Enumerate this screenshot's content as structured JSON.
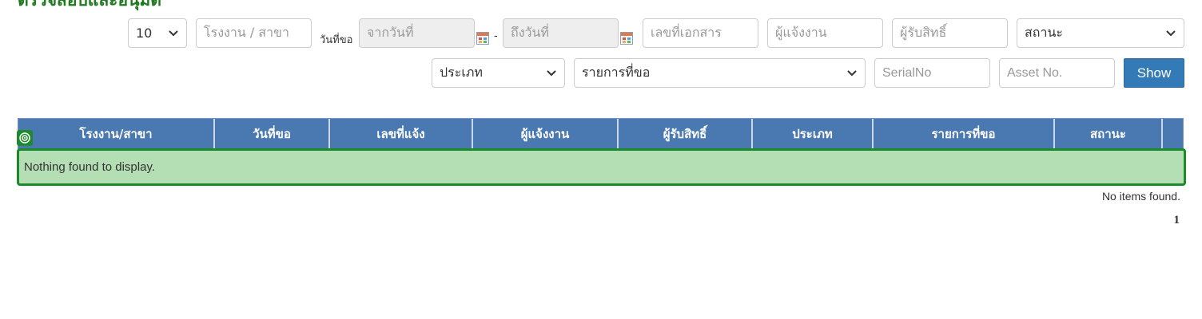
{
  "page": {
    "title": "ตรวจสอบและอนุมัติ"
  },
  "filters": {
    "page_size": "10",
    "branch_placeholder": "โรงงาน / สาขา",
    "request_date_label": "วันที่ขอ",
    "date_from_placeholder": "จากวันที่",
    "date_separator": "-",
    "date_to_placeholder": "ถึงวันที่",
    "doc_no_placeholder": "เลขที่เอกสาร",
    "reporter_placeholder": "ผู้แจ้งงาน",
    "grantee_placeholder": "ผู้รับสิทธิ์",
    "status_selected": "สถานะ",
    "type_selected": "ประเภท",
    "item_selected": "รายการที่ขอ",
    "serial_placeholder": "SerialNo",
    "asset_placeholder": "Asset No.",
    "show_label": "Show"
  },
  "grid": {
    "columns": [
      "โรงงาน/สาขา",
      "วันที่ขอ",
      "เลขที่แจ้ง",
      "ผู้แจ้งงาน",
      "ผู้รับสิทธิ์",
      "ประเภท",
      "รายการที่ขอ",
      "สถานะ"
    ],
    "empty_message": "Nothing found to display.",
    "footer_message": "No items found.",
    "current_page": "1"
  },
  "colors": {
    "header_bg": "#4a78b0",
    "empty_row_bg": "#b4deb4",
    "empty_row_border": "#1b8a2a",
    "show_button": "#337ab7",
    "title": "#1f7a1f"
  }
}
